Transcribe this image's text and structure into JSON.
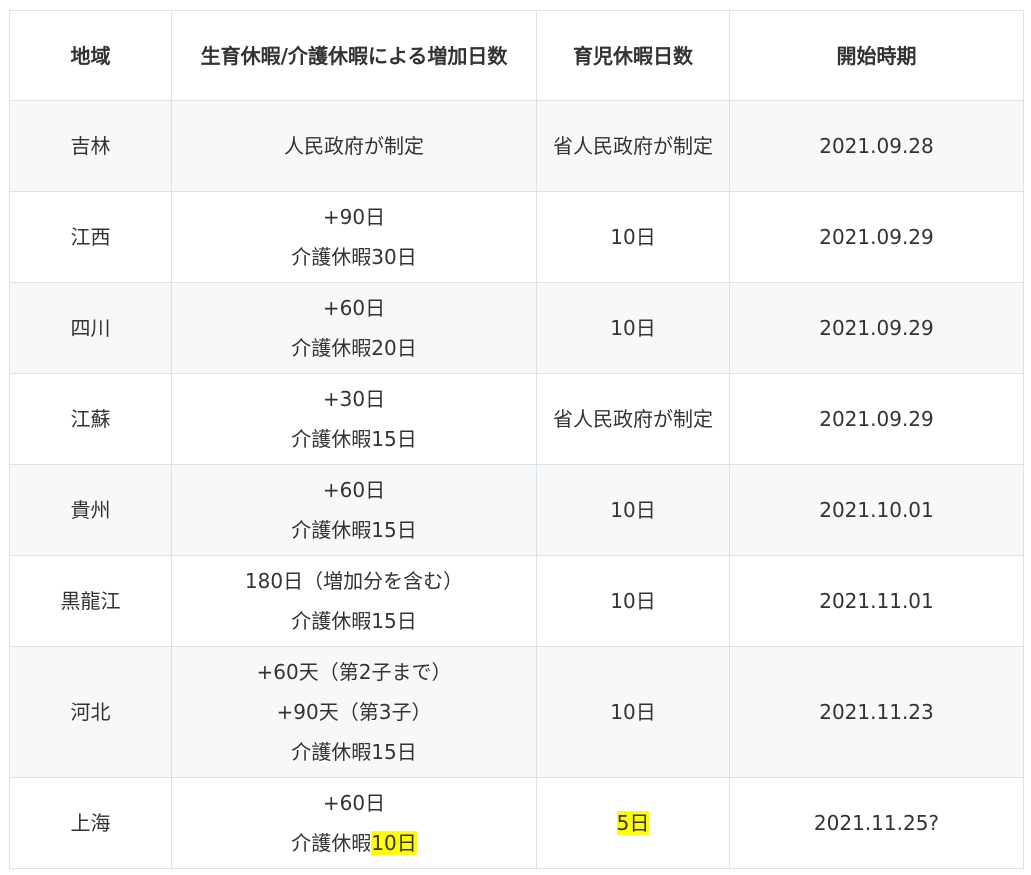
{
  "headers": [
    "地域",
    "生育休暇/介護休暇による増加日数",
    "育児休暇日数",
    "開始時期"
  ],
  "rows": [
    {
      "region": "吉林",
      "extra": [
        "人民政府が制定"
      ],
      "childcare": "省人民政府が制定",
      "start": "2021.09.28"
    },
    {
      "region": "江西",
      "extra": [
        "+90日",
        "介護休暇30日"
      ],
      "childcare": "10日",
      "start": "2021.09.29"
    },
    {
      "region": "四川",
      "extra": [
        "+60日",
        "介護休暇20日"
      ],
      "childcare": "10日",
      "start": "2021.09.29"
    },
    {
      "region": "江蘇",
      "extra": [
        "+30日",
        "介護休暇15日"
      ],
      "childcare": "省人民政府が制定",
      "start": "2021.09.29"
    },
    {
      "region": "貴州",
      "extra": [
        "+60日",
        "介護休暇15日"
      ],
      "childcare": "10日",
      "start": "2021.10.01"
    },
    {
      "region": "黒龍江",
      "extra": [
        "180日（増加分を含む）",
        "介護休暇15日"
      ],
      "childcare": "10日",
      "start": "2021.11.01"
    },
    {
      "region": "河北",
      "extra": [
        "+60天（第2子まで）",
        "+90天（第3子）",
        "介護休暇15日"
      ],
      "childcare": "10日",
      "start": "2021.11.23"
    },
    {
      "region": "上海",
      "extra": [
        "+60日"
      ],
      "extra_prefix": "介護休暇",
      "extra_highlight": "10日",
      "childcare_highlight": "5日",
      "start": "2021.11.25?"
    }
  ],
  "highlight_color": "#ffff00"
}
